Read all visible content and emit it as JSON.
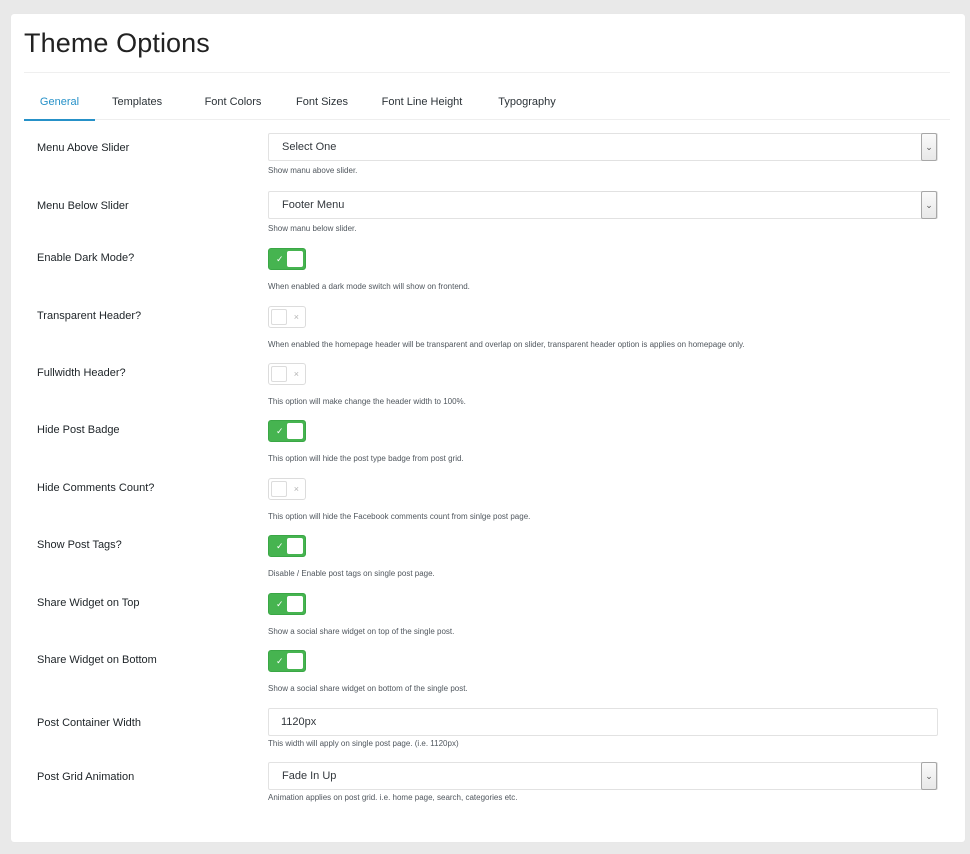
{
  "page": {
    "title": "Theme Options"
  },
  "tabs": [
    "General",
    "Templates",
    "Font Colors",
    "Font Sizes",
    "Font Line Height",
    "Typography"
  ],
  "fields": {
    "menu_above_slider": {
      "label": "Menu Above Slider",
      "value": "Select One",
      "help": "Show manu above slider."
    },
    "menu_below_slider": {
      "label": "Menu Below Slider",
      "value": "Footer Menu",
      "help": "Show manu below slider."
    },
    "dark_mode": {
      "label": "Enable Dark Mode?",
      "state": "on",
      "mark": "✓",
      "help": "When enabled a dark mode switch will show on frontend."
    },
    "transparent_header": {
      "label": "Transparent Header?",
      "state": "off",
      "mark": "×",
      "help": "When enabled the homepage header will be transparent and overlap on slider, transparent header option is applies on homepage only."
    },
    "fullwidth_header": {
      "label": "Fullwidth Header?",
      "state": "off",
      "mark": "×",
      "help": "This option will make change the header width to 100%."
    },
    "hide_post_badge": {
      "label": "Hide Post Badge",
      "state": "on",
      "mark": "✓",
      "help": "This option will hide the post type badge from post grid."
    },
    "hide_comments_count": {
      "label": "Hide Comments Count?",
      "state": "off",
      "mark": "×",
      "help": "This option will hide the Facebook comments count from sinlge post page."
    },
    "show_post_tags": {
      "label": "Show Post Tags?",
      "state": "on",
      "mark": "✓",
      "help": "Disable / Enable post tags on single post page."
    },
    "share_widget_top": {
      "label": "Share Widget on Top",
      "state": "on",
      "mark": "✓",
      "help": "Show a social share widget on top of the single post."
    },
    "share_widget_bottom": {
      "label": "Share Widget on Bottom",
      "state": "on",
      "mark": "✓",
      "help": "Show a social share widget on bottom of the single post."
    },
    "post_container_width": {
      "label": "Post Container Width",
      "value": "1120px",
      "help": "This width will apply on single post page. (i.e. 1120px)"
    },
    "post_grid_animation": {
      "label": "Post Grid Animation",
      "value": "Fade In Up",
      "help": "Animation applies on post grid. i.e. home page, search, categories etc."
    }
  },
  "icons": {
    "select_arrow": "chevron-down-icon"
  },
  "colors": {
    "accent": "#2691c8",
    "toggle_on": "#46b450"
  }
}
